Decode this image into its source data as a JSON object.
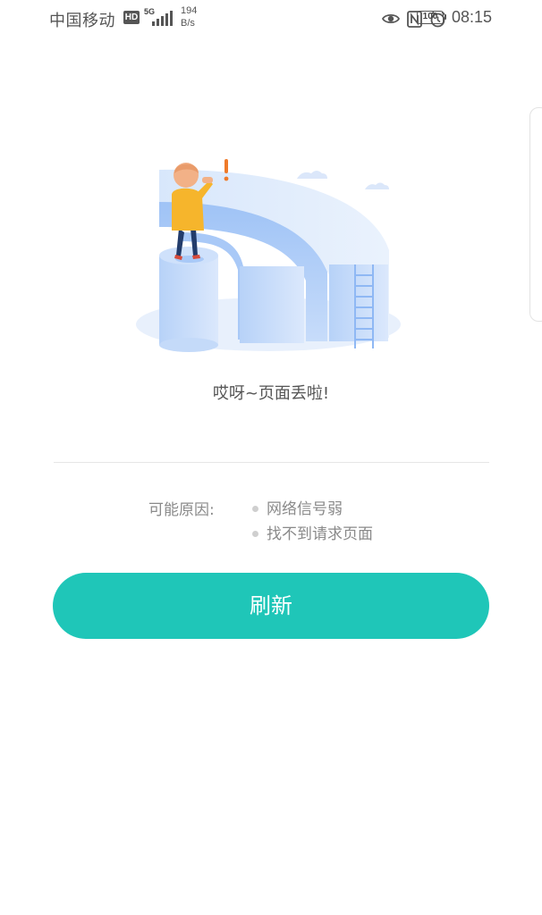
{
  "status_bar": {
    "carrier": "中国移动",
    "hd": "HD",
    "network": "5G",
    "speed_value": "194",
    "speed_unit": "B/s",
    "battery": "100",
    "time": "08:15",
    "icons": [
      "eye-icon",
      "nfc-icon",
      "alarm-icon"
    ]
  },
  "error": {
    "title": "哎呀~页面丢啦!"
  },
  "reasons": {
    "label": "可能原因:",
    "items": [
      "网络信号弱",
      "找不到请求页面"
    ]
  },
  "actions": {
    "refresh_label": "刷新"
  },
  "colors": {
    "accent": "#1fc6b8",
    "illustration_blue": "#8fb8f4",
    "figure_yellow": "#f6b52c"
  }
}
